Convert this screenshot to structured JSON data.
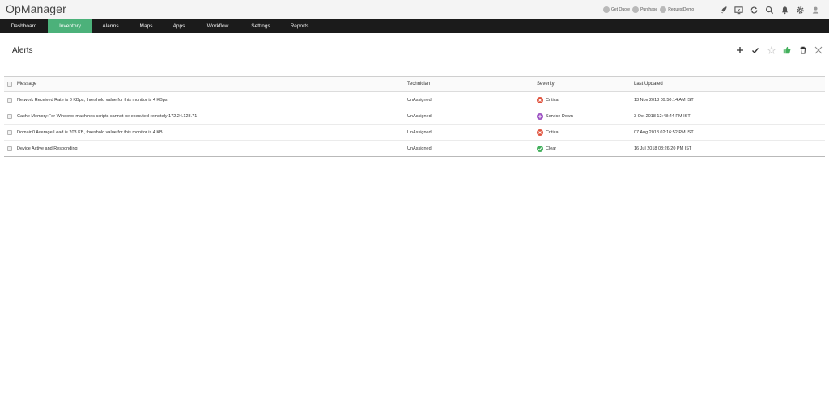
{
  "app": {
    "title": "OpManager"
  },
  "header": {
    "links": [
      {
        "label": "Get Quote"
      },
      {
        "label": "Purchase"
      },
      {
        "label": "RequestDemo"
      }
    ],
    "icons": [
      "rocket-icon",
      "monitor-icon",
      "sync-icon",
      "search-icon",
      "bell-icon",
      "gear-icon",
      "user-icon"
    ]
  },
  "nav": {
    "items": [
      {
        "label": "Dashboard"
      },
      {
        "label": "Inventory",
        "active": true
      },
      {
        "label": "Alarms"
      },
      {
        "label": "Maps"
      },
      {
        "label": "Apps"
      },
      {
        "label": "Workflow"
      },
      {
        "label": "Settings"
      },
      {
        "label": "Reports"
      }
    ]
  },
  "page": {
    "title": "Alerts",
    "actions": [
      "add-icon",
      "check-icon",
      "star-icon",
      "thumbs-up-icon",
      "trash-icon",
      "close-icon"
    ]
  },
  "table": {
    "columns": [
      "Message",
      "Technician",
      "Severity",
      "Last Updated"
    ],
    "rows": [
      {
        "message": "Network Received Rate is 8 KBps, threshold value for this monitor is 4 KBps",
        "technician": "UnAssigned",
        "severity": "Critical",
        "severity_color": "#e0533e",
        "updated": "13 Nov 2018 09:50:14 AM IST"
      },
      {
        "message": "Cache Memory:For Windows machines scripts cannot be executed remotely:172.24.128.71",
        "technician": "UnAssigned",
        "severity": "Service Down",
        "severity_color": "#9b4fc2",
        "updated": "3 Oct 2018 12:48:44 PM IST"
      },
      {
        "message": "Domain0 Average Load is 203 KB, threshold value for this monitor is 4 KB",
        "technician": "UnAssigned",
        "severity": "Critical",
        "severity_color": "#e0533e",
        "updated": "07 Aug 2018 02:16:52 PM IST"
      },
      {
        "message": "Device Active and Responding",
        "technician": "UnAssigned",
        "severity": "Clear",
        "severity_color": "#43b05c",
        "updated": "16 Jul 2018 08:26:20 PM IST"
      }
    ]
  },
  "colors": {
    "nav_bg": "#1b1b1b",
    "nav_active": "#4cb17a",
    "accent_green": "#43b05c"
  }
}
